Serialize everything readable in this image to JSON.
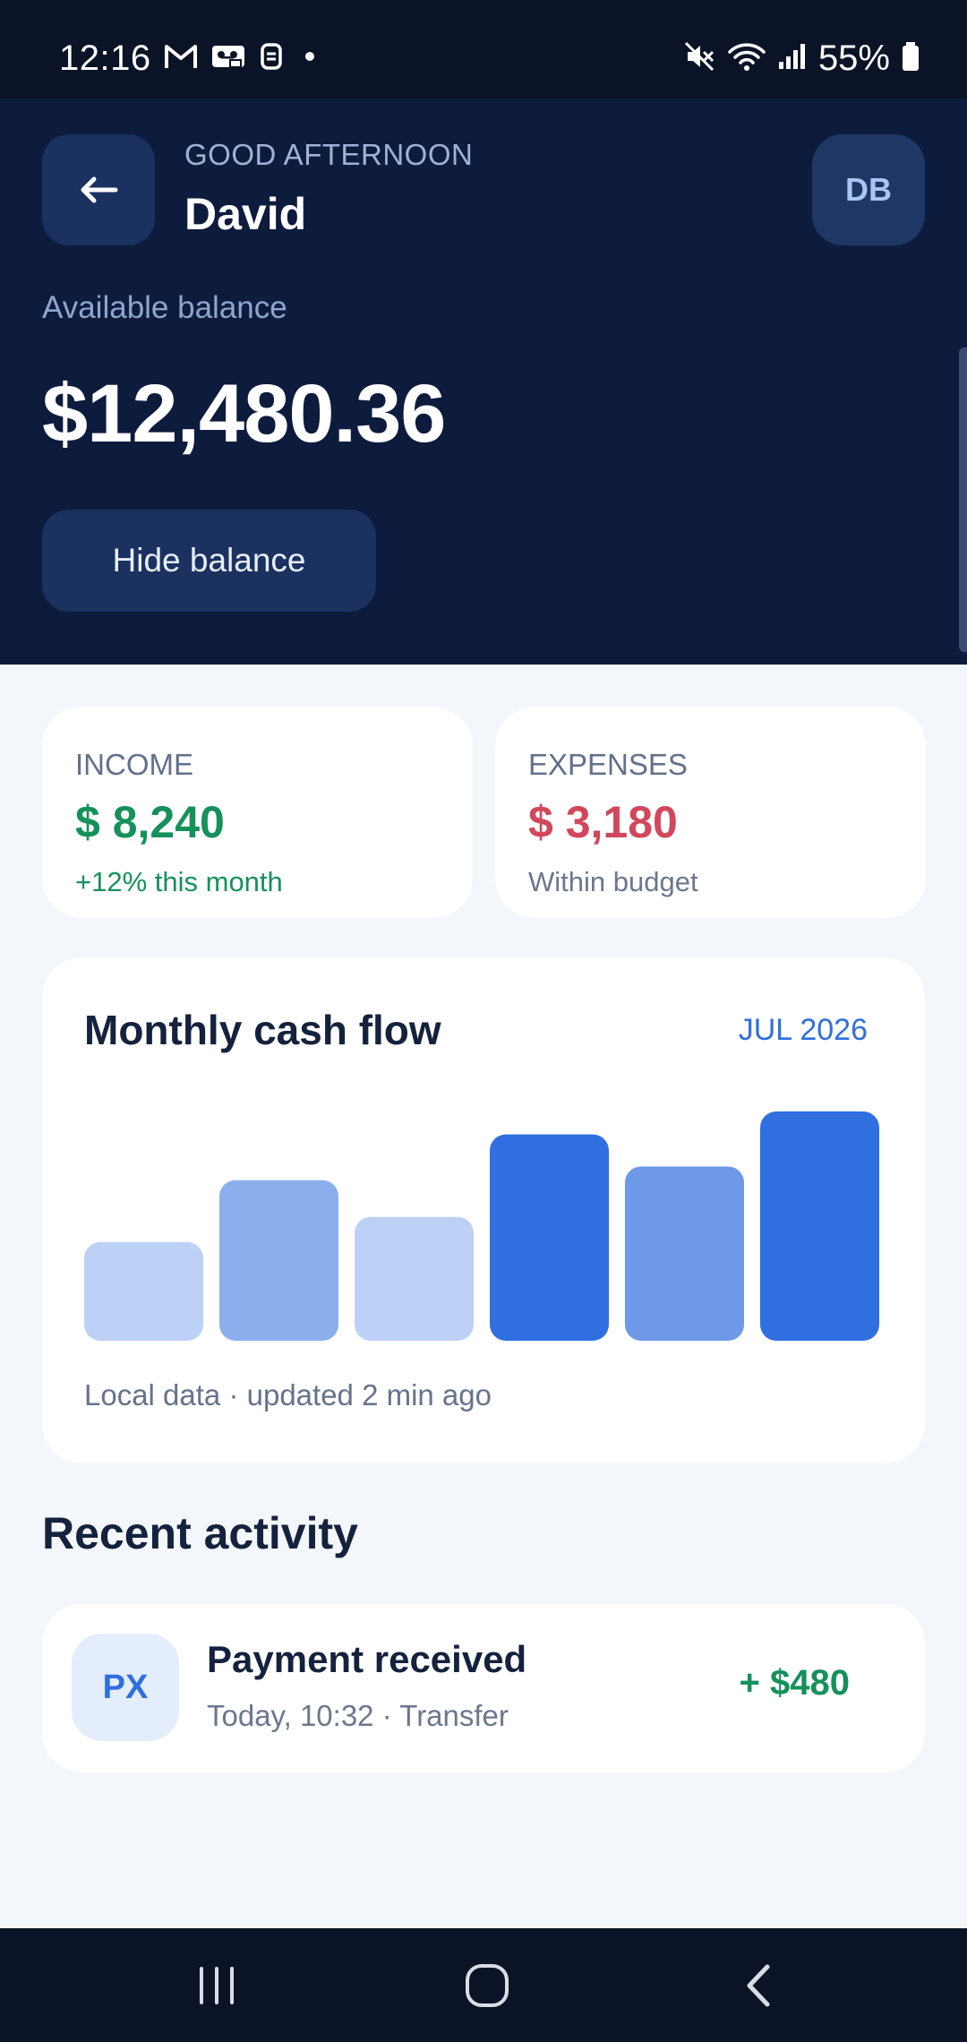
{
  "status_bar": {
    "time": "12:16",
    "battery": "55%",
    "icons": [
      "gmail-icon",
      "voicemail-icon",
      "sim-icon",
      "dot-icon",
      "mute-icon",
      "wifi-icon",
      "signal-icon",
      "battery-icon"
    ]
  },
  "header": {
    "greeting": "GOOD AFTERNOON",
    "name": "David",
    "avatar_initials": "DB",
    "balance_label": "Available balance",
    "balance_amount": "$12,480.36",
    "hide_balance_label": "Hide balance"
  },
  "summary": {
    "income": {
      "label": "INCOME",
      "amount": "$ 8,240",
      "note": "+12% this month",
      "color": "#15915b"
    },
    "expenses": {
      "label": "EXPENSES",
      "amount": "$ 3,180",
      "note": "Within budget",
      "color": "#d2475b"
    }
  },
  "cash_flow": {
    "title": "Monthly cash flow",
    "period": "JUL 2026",
    "footnote": "Local data · updated 2 min ago"
  },
  "chart_data": {
    "type": "bar",
    "title": "Monthly cash flow",
    "values": [
      43,
      70,
      54,
      90,
      76,
      100
    ],
    "colors": [
      "#bdd1f6",
      "#8baeed",
      "#bdd1f6",
      "#2f6fe0",
      "#6e98e8",
      "#2f6fe0"
    ]
  },
  "recent_activity": {
    "title": "Recent activity",
    "items": [
      {
        "badge": "PX",
        "title": "Payment received",
        "meta": "Today, 10:32 · Transfer",
        "amount": "+ $480"
      }
    ]
  },
  "colors": {
    "hero_bg": "#0d1b3d",
    "accent": "#2f6fe0",
    "page_bg": "#f3f6fb"
  },
  "nav": {
    "items": [
      "recents-icon",
      "home-icon",
      "back-icon"
    ]
  }
}
